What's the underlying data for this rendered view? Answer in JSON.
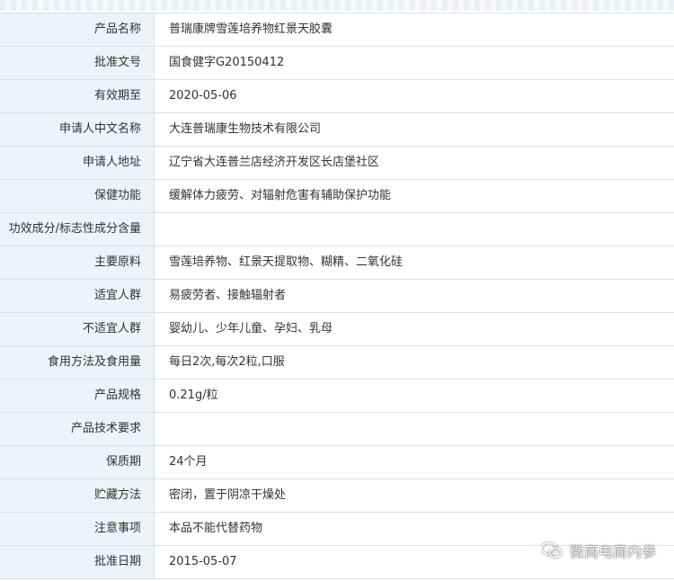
{
  "rows": [
    {
      "label": "产品名称",
      "value": "普瑞康牌雪莲培养物红景天胶囊"
    },
    {
      "label": "批准文号",
      "value": "国食健字G20150412"
    },
    {
      "label": "有效期至",
      "value": "2020-05-06"
    },
    {
      "label": "申请人中文名称",
      "value": "大连普瑞康生物技术有限公司"
    },
    {
      "label": "申请人地址",
      "value": "辽宁省大连普兰店经济开发区长店堡社区"
    },
    {
      "label": "保健功能",
      "value": "缓解体力疲劳、对辐射危害有辅助保护功能"
    },
    {
      "label": "功效成分/标志性成分含量",
      "value": ""
    },
    {
      "label": "主要原料",
      "value": "雪莲培养物、红景天提取物、糊精、二氧化硅"
    },
    {
      "label": "适宜人群",
      "value": "易疲劳者、接触辐射者"
    },
    {
      "label": "不适宜人群",
      "value": "婴幼儿、少年儿童、孕妇、乳母"
    },
    {
      "label": "食用方法及食用量",
      "value": "每日2次,每次2粒,口服"
    },
    {
      "label": "产品规格",
      "value": "0.21g/粒"
    },
    {
      "label": "产品技术要求",
      "value": ""
    },
    {
      "label": "保质期",
      "value": "24个月"
    },
    {
      "label": "贮藏方法",
      "value": "密闭，置于阴凉干燥处"
    },
    {
      "label": "注意事项",
      "value": "本品不能代替药物"
    },
    {
      "label": "批准日期",
      "value": "2015-05-07"
    }
  ],
  "watermark": {
    "icon": "wechat-icon",
    "text": "微商电商内参"
  },
  "colors": {
    "label_bg": "#eef2f9",
    "border": "#d9e1ee",
    "text": "#333333"
  }
}
